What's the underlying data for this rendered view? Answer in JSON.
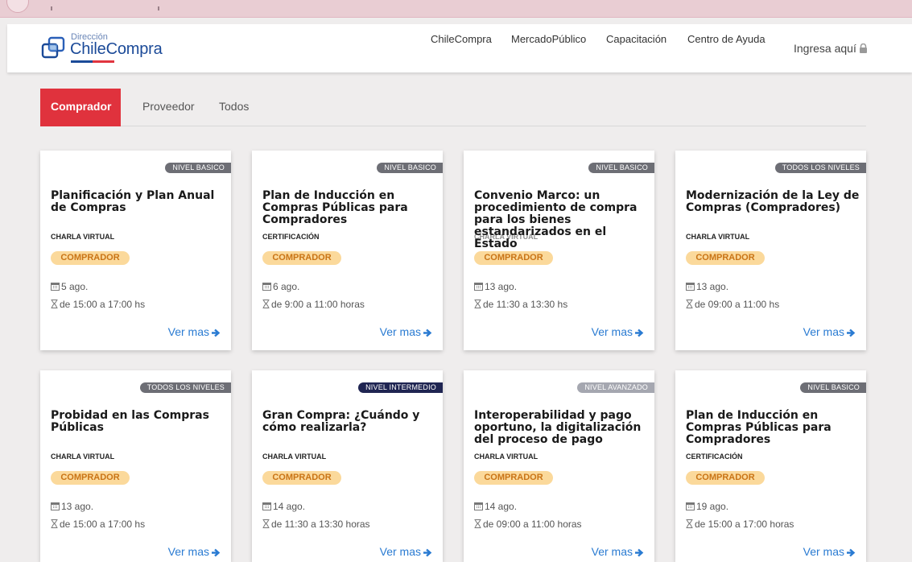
{
  "header": {
    "logo_sub": "Dirección",
    "logo_name": "ChileCompra",
    "nav": [
      "ChileCompra",
      "MercadoPúblico",
      "Capacitación",
      "Centro de Ayuda"
    ],
    "login": "Ingresa aquí"
  },
  "tabs": [
    "Comprador",
    "Proveedor",
    "Todos"
  ],
  "cards": [
    {
      "level": "NIVEL BASICO",
      "title": "Planificación y Plan Anual de Compras",
      "type": "CHARLA VIRTUAL",
      "badge": "COMPRADOR",
      "date": "5 ago.",
      "time": "de 15:00 a 17:00 hs",
      "more": "Ver mas"
    },
    {
      "level": "NIVEL BASICO",
      "title": "Plan de Inducción en Compras Públicas para Compradores",
      "type": "CERTIFICACIóN",
      "badge": "COMPRADOR",
      "date": "6 ago.",
      "time": "de 9:00 a 11:00 horas",
      "more": "Ver mas"
    },
    {
      "level": "NIVEL BASICO",
      "title": "Convenio Marco: un procedimiento de compra para los bienes estandarizados en el Estado",
      "type": "CHARLA VIRTUAL",
      "badge": "COMPRADOR",
      "date": "13 ago.",
      "time": "de 11:30 a 13:30 hs",
      "more": "Ver mas"
    },
    {
      "level": "TODOS LOS NIVELES",
      "title": "Modernización de la Ley de Compras (Compradores)",
      "type": "CHARLA VIRTUAL",
      "badge": "COMPRADOR",
      "date": "13 ago.",
      "time": "de 09:00 a 11:00 hs",
      "more": "Ver mas"
    },
    {
      "level": "TODOS LOS NIVELES",
      "title": "Probidad en las Compras Públicas",
      "type": "CHARLA VIRTUAL",
      "badge": "COMPRADOR",
      "date": "13 ago.",
      "time": "de 15:00 a 17:00 hs",
      "more": "Ver mas"
    },
    {
      "level": "NIVEL INTERMEDIO",
      "title": "Gran Compra: ¿Cuándo y cómo realizarla?",
      "type": "CHARLA VIRTUAL",
      "badge": "COMPRADOR",
      "date": "14 ago.",
      "time": "de 11:30 a 13:30 horas",
      "more": "Ver mas"
    },
    {
      "level": "NIVEL AVANZADO",
      "title": "Interoperabilidad y pago oportuno, la digitalización del proceso de pago",
      "type": "CHARLA VIRTUAL",
      "badge": "COMPRADOR",
      "date": "14 ago.",
      "time": "de 09:00 a 11:00 horas",
      "more": "Ver mas"
    },
    {
      "level": "NIVEL BASICO",
      "title": "Plan de Inducción en Compras Públicas para Compradores",
      "type": "CERTIFICACIóN",
      "badge": "COMPRADOR",
      "date": "19 ago.",
      "time": "de 15:00 a 17:00 horas",
      "more": "Ver mas"
    }
  ],
  "colors": {
    "accent": "#e0323d",
    "badge_bg": "#fbd99b",
    "badge_text": "#c97416",
    "link": "#2a7bd2",
    "brand": "#1b4a98"
  }
}
